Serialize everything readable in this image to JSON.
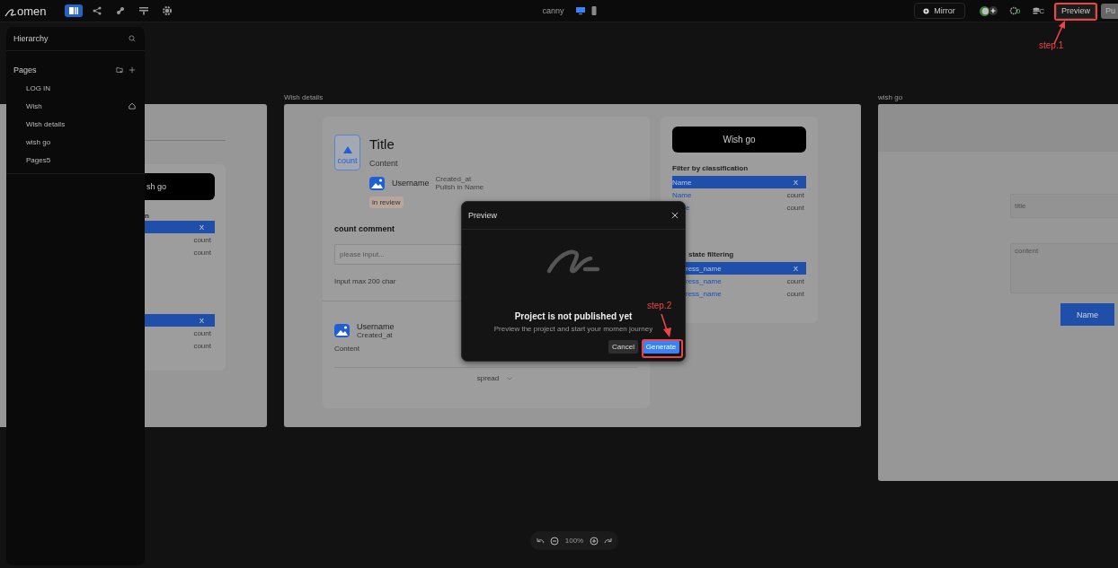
{
  "topbar": {
    "logo": "omen",
    "tools": [
      {
        "kind": "pages",
        "selected": true
      },
      {
        "kind": "share",
        "selected": false
      },
      {
        "kind": "plugin",
        "selected": false
      },
      {
        "kind": "layout",
        "selected": false
      },
      {
        "kind": "settings",
        "selected": false
      }
    ],
    "project": "canny",
    "devices": [
      {
        "kind": "desktop",
        "selected": true
      },
      {
        "kind": "mobile",
        "selected": false
      }
    ],
    "mirror": "Mirror",
    "status_icons": [
      {
        "kind": "bug",
        "badge": "0"
      },
      {
        "kind": "database",
        "badge": "C"
      }
    ],
    "preview": "Preview",
    "publish": "Pu"
  },
  "sidebar": {
    "title": "Hierarchy",
    "section": "Pages",
    "pages": [
      {
        "label": "LOG IN",
        "home": false
      },
      {
        "label": "Wish",
        "home": true
      },
      {
        "label": "Wish details",
        "home": false
      },
      {
        "label": "wish go",
        "home": false
      },
      {
        "label": "Pages5",
        "home": false
      }
    ]
  },
  "artboards": [
    {
      "kind": "list_page",
      "button": "sh go",
      "groups": [
        {
          "title": "n",
          "rows": [
            {
              "trailing": "X",
              "selected": true
            },
            {
              "trailing": "count",
              "selected": false
            },
            {
              "trailing": "count",
              "selected": false
            }
          ]
        },
        {
          "rows": [
            {
              "trailing": "X",
              "selected": true
            },
            {
              "trailing": "count",
              "selected": false
            },
            {
              "trailing": "count",
              "selected": false
            }
          ]
        }
      ]
    },
    {
      "kind": "details_page",
      "label": "Wish details",
      "vote": "count",
      "title": "Title",
      "content": "Content",
      "author": {
        "name": "Username",
        "created": "Created_at",
        "publisher": "Pulish in Name"
      },
      "status": "in review",
      "comment_heading": "count comment",
      "comment_placeholder": "please input...",
      "comment_hint": "Input max 200 char",
      "comments": [
        {
          "name": "Username",
          "created": "Created_at",
          "content": "Content"
        }
      ],
      "expand": "spread",
      "side": {
        "button": "Wish go",
        "groups": [
          {
            "title": "Filter by classification",
            "clipped": false,
            "rows": [
              {
                "label": "Name",
                "trailing": "X",
                "selected": true,
                "clipped": false
              },
              {
                "label": "Name",
                "trailing": "count",
                "selected": false,
                "clipped": false
              },
              {
                "label": "e",
                "trailing": "count",
                "selected": false,
                "clipped": true
              }
            ]
          },
          {
            "title": "state filtering",
            "clipped": true,
            "rows": [
              {
                "label": "ress_name",
                "trailing": "X",
                "selected": true,
                "clipped": true
              },
              {
                "label": "ress_name",
                "trailing": "count",
                "selected": false,
                "clipped": true
              },
              {
                "label": "ress_name",
                "trailing": "count",
                "selected": false,
                "clipped": true
              }
            ]
          }
        ]
      }
    },
    {
      "kind": "form_page",
      "label": "wish go",
      "fields": [
        {
          "placeholder": "title",
          "kind": "line"
        },
        {
          "placeholder": "content",
          "kind": "area"
        }
      ],
      "button": "Name"
    }
  ],
  "dialog": {
    "title": "Preview",
    "heading": "Project is not published yet",
    "text": "Preview the project and start your momen journey",
    "buttons": [
      {
        "label": "Cancel",
        "kind": "secondary"
      },
      {
        "label": "Generate",
        "kind": "primary"
      }
    ]
  },
  "annotations": [
    {
      "text": "step.1",
      "kind": "top"
    },
    {
      "text": "step.2",
      "kind": "dialog"
    }
  ],
  "zoom": {
    "reading": "100%"
  }
}
